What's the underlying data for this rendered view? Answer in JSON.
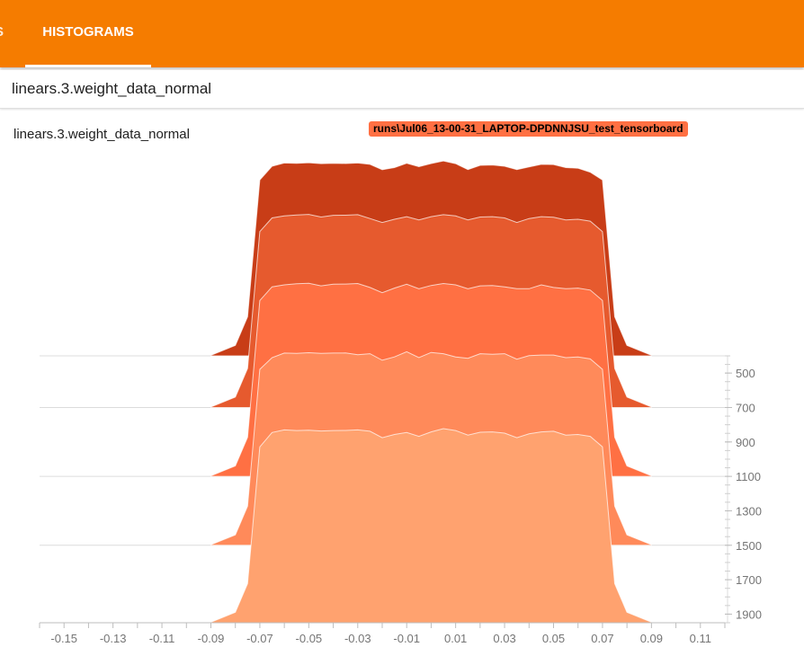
{
  "tabs": {
    "prev_partial": "S",
    "active": "HISTOGRAMS"
  },
  "search": {
    "value": "linears.3.weight_data_normal"
  },
  "card": {
    "title": "linears.3.weight_data_normal",
    "run": "runs\\Jul06_13-00-31_LAPTOP-DPDNNJSU_test_tensorboard"
  },
  "colors": {
    "header": "#f57c00",
    "run_tag": "#ff7043",
    "histogram_layers": [
      "#ffa26f",
      "#ff8a5a",
      "#ff7043",
      "#e65a2e",
      "#c83d17"
    ]
  },
  "chart_data": {
    "type": "area",
    "subtype": "tensorboard-histogram-offset",
    "x_ticks": [
      "-0.15",
      "-0.13",
      "-0.11",
      "-0.09",
      "-0.07",
      "-0.05",
      "-0.03",
      "-0.01",
      "0.01",
      "0.03",
      "0.05",
      "0.07",
      "0.09",
      "0.11"
    ],
    "xlim": [
      -0.16,
      0.12
    ],
    "y_ticks": [
      "500",
      "700",
      "900",
      "1100",
      "1300",
      "1500",
      "1700",
      "1900"
    ],
    "ylim_steps": [
      400,
      1950
    ],
    "x": [
      -0.09,
      -0.08,
      -0.075,
      -0.07,
      -0.065,
      -0.06,
      -0.055,
      -0.05,
      -0.045,
      -0.04,
      -0.035,
      -0.03,
      -0.025,
      -0.02,
      -0.015,
      -0.01,
      -0.005,
      0.0,
      0.005,
      0.01,
      0.015,
      0.02,
      0.025,
      0.03,
      0.035,
      0.04,
      0.045,
      0.05,
      0.055,
      0.06,
      0.065,
      0.07,
      0.075,
      0.08,
      0.09
    ],
    "series": [
      {
        "step": 1950,
        "values": [
          4,
          80,
          300,
          1350,
          1460,
          1480,
          1475,
          1478,
          1472,
          1475,
          1476,
          1480,
          1470,
          1420,
          1445,
          1460,
          1430,
          1465,
          1490,
          1475,
          1440,
          1462,
          1465,
          1455,
          1420,
          1450,
          1465,
          1470,
          1440,
          1445,
          1430,
          1350,
          300,
          80,
          4
        ]
      },
      {
        "step": 1500,
        "values": [
          4,
          80,
          300,
          1350,
          1440,
          1475,
          1472,
          1478,
          1472,
          1475,
          1476,
          1462,
          1470,
          1420,
          1445,
          1485,
          1440,
          1480,
          1470,
          1445,
          1435,
          1470,
          1465,
          1470,
          1428,
          1455,
          1460,
          1460,
          1440,
          1445,
          1430,
          1350,
          300,
          80,
          4
        ]
      },
      {
        "step": 1100,
        "values": [
          4,
          80,
          300,
          1350,
          1455,
          1470,
          1478,
          1482,
          1462,
          1475,
          1476,
          1480,
          1450,
          1410,
          1445,
          1475,
          1440,
          1465,
          1480,
          1470,
          1440,
          1462,
          1465,
          1455,
          1440,
          1440,
          1470,
          1450,
          1440,
          1445,
          1430,
          1350,
          300,
          80,
          4
        ]
      },
      {
        "step": 700,
        "values": [
          4,
          80,
          300,
          1350,
          1455,
          1470,
          1478,
          1482,
          1462,
          1475,
          1476,
          1480,
          1450,
          1420,
          1445,
          1465,
          1440,
          1465,
          1480,
          1470,
          1440,
          1462,
          1465,
          1455,
          1420,
          1450,
          1465,
          1460,
          1440,
          1445,
          1430,
          1350,
          300,
          80,
          4
        ]
      },
      {
        "step": 400,
        "values": [
          4,
          80,
          300,
          1350,
          1455,
          1480,
          1478,
          1482,
          1475,
          1478,
          1476,
          1480,
          1470,
          1428,
          1445,
          1478,
          1452,
          1476,
          1496,
          1475,
          1430,
          1462,
          1465,
          1455,
          1430,
          1450,
          1470,
          1468,
          1445,
          1440,
          1410,
          1350,
          300,
          80,
          4
        ]
      }
    ]
  }
}
